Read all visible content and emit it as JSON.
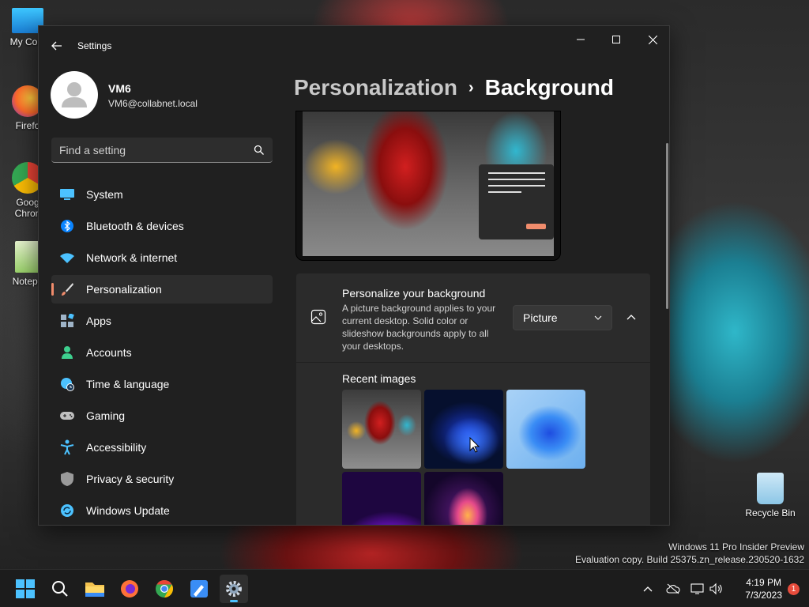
{
  "desktop": {
    "icons": [
      {
        "label": "My Com",
        "icon": "computer-icon"
      },
      {
        "label": "Firefo",
        "icon": "firefox-icon"
      },
      {
        "label": "Goog Chron",
        "icon": "chrome-icon"
      },
      {
        "label": "Notepa",
        "icon": "notepad-icon"
      }
    ],
    "recycle_bin": "Recycle Bin",
    "watermark": {
      "line1": "Windows 11 Pro Insider Preview",
      "line2": "Evaluation copy. Build 25375.zn_release.230520-1632"
    }
  },
  "window": {
    "title": "Settings",
    "user": {
      "name": "VM6",
      "email": "VM6@collabnet.local"
    },
    "search": {
      "placeholder": "Find a setting"
    },
    "nav": [
      {
        "label": "System",
        "icon": "system-monitor-icon",
        "color": "#4cc2ff"
      },
      {
        "label": "Bluetooth & devices",
        "icon": "bluetooth-icon",
        "color": "#0a84ff"
      },
      {
        "label": "Network & internet",
        "icon": "wifi-icon",
        "color": "#4cc2ff"
      },
      {
        "label": "Personalization",
        "icon": "brush-icon",
        "color": "#f08c6c",
        "selected": true
      },
      {
        "label": "Apps",
        "icon": "apps-icon",
        "color": "#9fb4c8"
      },
      {
        "label": "Accounts",
        "icon": "accounts-icon",
        "color": "#3ecf8e"
      },
      {
        "label": "Time & language",
        "icon": "globe-clock-icon",
        "color": "#4cc2ff"
      },
      {
        "label": "Gaming",
        "icon": "gamepad-icon",
        "color": "#bfbfbf"
      },
      {
        "label": "Accessibility",
        "icon": "accessibility-icon",
        "color": "#4cc2ff"
      },
      {
        "label": "Privacy & security",
        "icon": "shield-icon",
        "color": "#9a9a9a"
      },
      {
        "label": "Windows Update",
        "icon": "update-icon",
        "color": "#4cc2ff"
      }
    ],
    "breadcrumb": {
      "parent": "Personalization",
      "separator": "›",
      "current": "Background"
    },
    "background_card": {
      "title": "Personalize your background",
      "description": "A picture background applies to your current desktop. Solid color or slideshow backgrounds apply to all your desktops.",
      "dropdown_value": "Picture"
    },
    "recent_images": {
      "label": "Recent images",
      "images": [
        "red-character-image",
        "blue-bloom-dark-image",
        "blue-bloom-light-image",
        "purple-gradient-image",
        "colorful-flower-image"
      ]
    }
  },
  "taskbar": {
    "apps": [
      "start-icon",
      "search-icon",
      "file-explorer-icon",
      "firefox-icon",
      "chrome-icon",
      "paint-icon",
      "settings-icon"
    ],
    "time": "4:19 PM",
    "date": "7/3/2023",
    "notification_count": "1"
  },
  "colors": {
    "accent": "#4cc2ff",
    "selection": "#f08c6c"
  }
}
